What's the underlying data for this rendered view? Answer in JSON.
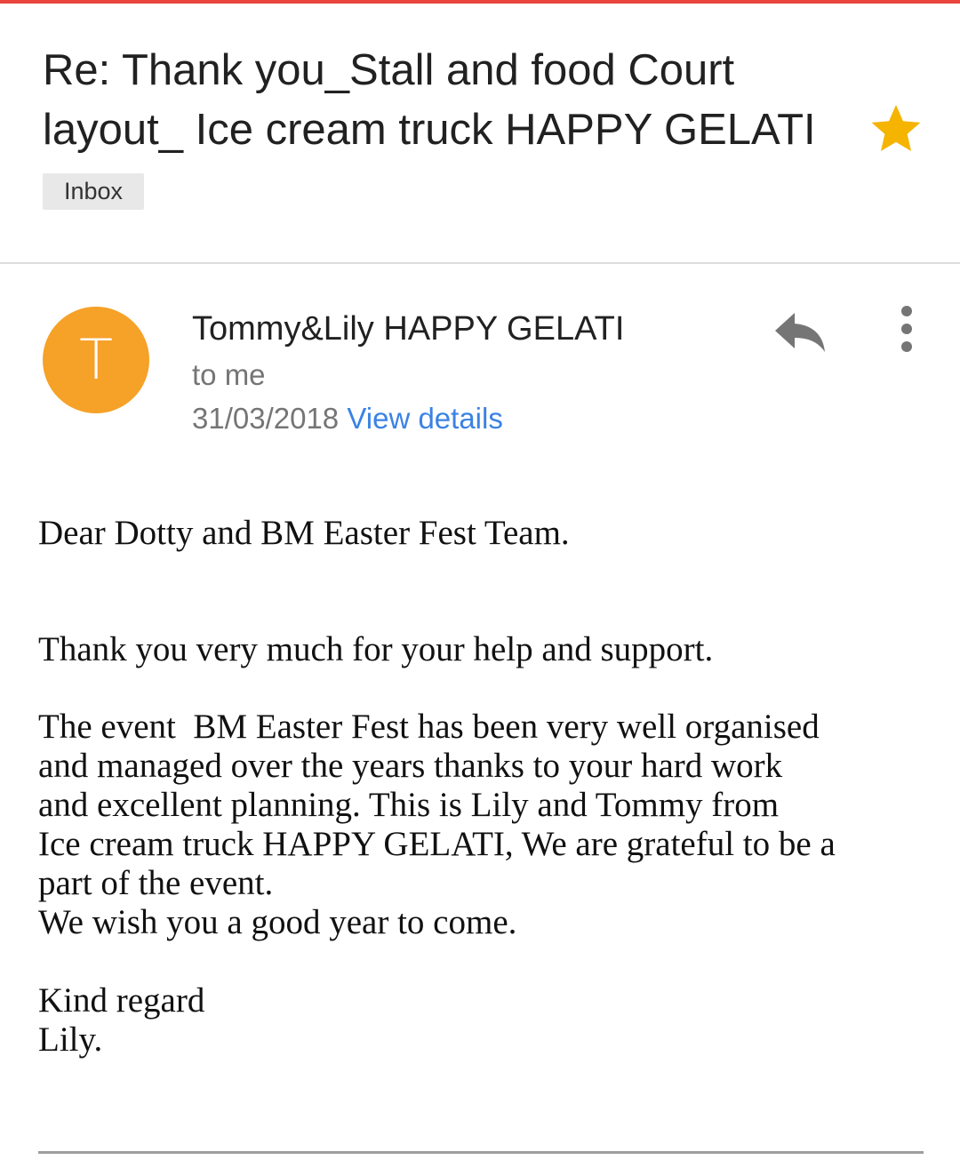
{
  "email": {
    "subject": "Re: Thank you_Stall and food Court layout_ Ice cream truck HAPPY GELATI",
    "label": "Inbox",
    "starred": true,
    "sender_name": "Tommy&Lily HAPPY GELATI",
    "avatar_letter": "T",
    "recipient": "to me",
    "date": "31/03/2018",
    "view_details": "View details"
  },
  "body": {
    "greeting": "Dear Dotty and BM Easter Fest Team.",
    "thanks": "Thank you very much for your help and support.",
    "paragraph": "The event  BM Easter Fest has been very well organised\nand managed over the years thanks to your hard work\nand excellent planning. This is Lily and Tommy from\nIce cream truck HAPPY GELATI, We are grateful to be a\npart of the event.\nWe wish you a good year to come.",
    "closing": "Kind regard\nLily."
  },
  "icons": {
    "star": "star-icon",
    "reply": "reply-icon",
    "more": "more-vert-icon"
  },
  "colors": {
    "accent_top": "#e8453c",
    "star": "#f5b400",
    "avatar": "#f6a128",
    "link": "#3b82e4"
  }
}
